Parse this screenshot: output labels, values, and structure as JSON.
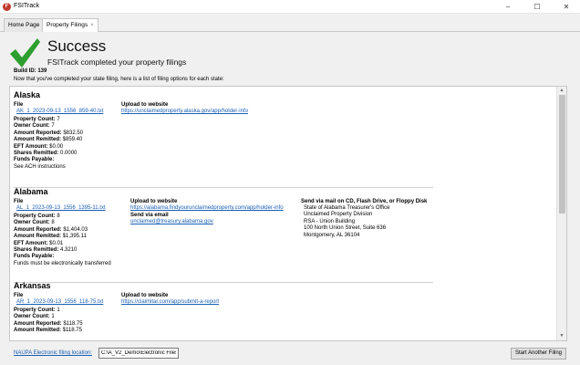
{
  "window": {
    "title": "FSITrack",
    "icon": "app-logo-icon",
    "controls": [
      "minimize-icon",
      "maximize-icon",
      "close-icon"
    ],
    "minimize_glyph": "–",
    "maximize_glyph": "☐",
    "close_glyph": "✕"
  },
  "tabs": [
    {
      "label": "Home Page",
      "active": false
    },
    {
      "label": "Property Filings",
      "active": true,
      "close": "×"
    }
  ],
  "header": {
    "title": "Success",
    "subtitle": "FSITrack completed your property filings",
    "build_id": "Build ID: 139",
    "intro": "Now that you've completed your state filing, here is a list of filing options for each state:"
  },
  "states": [
    {
      "name": "Alaska",
      "file_header": "File",
      "file_link": "AK_1_2023-09-13_1556_859-40.txt",
      "upload_header": "Upload to website",
      "upload_link": "https://unclaimedproperty.alaska.gov/app/holder-info",
      "fields": [
        {
          "label": "Property Count:",
          "value": "7"
        },
        {
          "label": "Owner Count:",
          "value": "7"
        },
        {
          "label": "Amount Reported:",
          "value": "$832.50"
        },
        {
          "label": "Amount Remitted:",
          "value": "$859.40"
        },
        {
          "label": "EFT Amount:",
          "value": "$0.00"
        },
        {
          "label": "Shares Remitted:",
          "value": "0.0000"
        },
        {
          "label": "Funds Payable:",
          "value": ""
        }
      ],
      "note": "See ACH instructions"
    },
    {
      "name": "Alabama",
      "file_header": "File",
      "file_link": "AL_1_2023-09-13_1556_1395-11.txt",
      "upload_header": "Upload to website",
      "upload_link": "https://alabama.findyourunclaimedproperty.com/app/holder-info",
      "email_header": "Send via email",
      "email_link": "unclaimed@treasury.alabama.gov",
      "mail_header": "Send via mail on CD, Flash Drive, or Floppy Disk",
      "mail_lines": [
        "State of Alabama Treasurer's Office",
        "Unclaimed Property Division",
        "RSA - Union Building",
        "100 North Union Street, Suite 636",
        "Montgomery, AL 36104"
      ],
      "fields": [
        {
          "label": "Property Count:",
          "value": "8"
        },
        {
          "label": "Owner Count:",
          "value": "8"
        },
        {
          "label": "Amount Reported:",
          "value": "$1,404.03"
        },
        {
          "label": "Amount Remitted:",
          "value": "$1,395.11"
        },
        {
          "label": "EFT Amount:",
          "value": "$0.01"
        },
        {
          "label": "Shares Remitted:",
          "value": "4.3210"
        },
        {
          "label": "Funds Payable:",
          "value": ""
        }
      ],
      "note": "Funds must be electronically transferred"
    },
    {
      "name": "Arkansas",
      "file_header": "File",
      "file_link": "AR_1_2023-09-13_1556_118-75.txt",
      "upload_header": "Upload to website",
      "upload_link": "https://claimitar.com/app/submit-a-report",
      "fields": [
        {
          "label": "Property Count:",
          "value": "1"
        },
        {
          "label": "Owner Count:",
          "value": "1"
        },
        {
          "label": "Amount Reported:",
          "value": "$118.75"
        },
        {
          "label": "Amount Remitted:",
          "value": "$118.75"
        }
      ]
    }
  ],
  "footer": {
    "location_label": "NAUPA Electronic filing location:",
    "location_value": "C:\\A_V2_Demo\\Electronic Files",
    "restart_button": "Start Another Filing"
  },
  "colors": {
    "link": "#1a5fb4",
    "check": "#2e9e2e",
    "app_icon": "#c0392b"
  }
}
